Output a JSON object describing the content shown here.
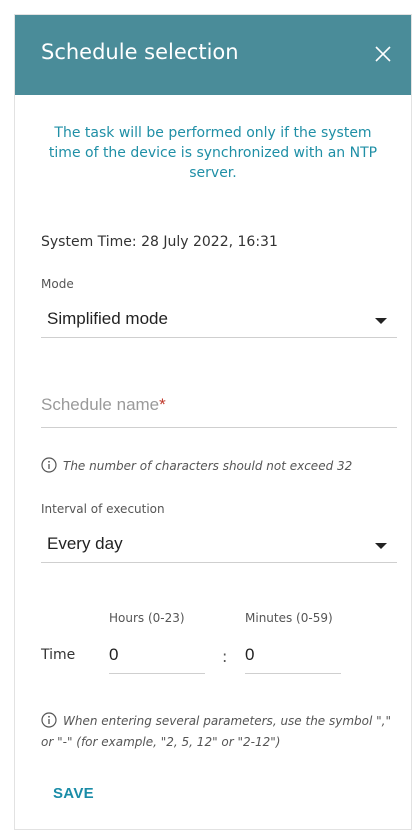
{
  "dialog": {
    "title": "Schedule selection",
    "close_icon": "close-icon"
  },
  "notice": "The task will be performed only if the system time of the device is synchronized with an NTP server.",
  "system_time": "System Time: 28 July 2022, 16:31",
  "mode": {
    "label": "Mode",
    "value": "Simplified mode"
  },
  "schedule_name": {
    "placeholder": "Schedule name",
    "required_mark": "*"
  },
  "name_hint": "The number of characters should not exceed 32",
  "interval": {
    "label": "Interval of execution",
    "value": "Every day"
  },
  "time": {
    "label": "Time",
    "hours_label": "Hours (0-23)",
    "minutes_label": "Minutes (0-59)",
    "hours_value": "0",
    "minutes_value": "0",
    "separator": ":"
  },
  "param_hint": "When entering several parameters, use the symbol \",\" or \"-\" (for example, \"2, 5, 12\" or \"2-12\")",
  "save_label": "SAVE",
  "colors": {
    "header": "#4a8c99",
    "accent": "#1f8fa6",
    "required": "#c0392b"
  }
}
